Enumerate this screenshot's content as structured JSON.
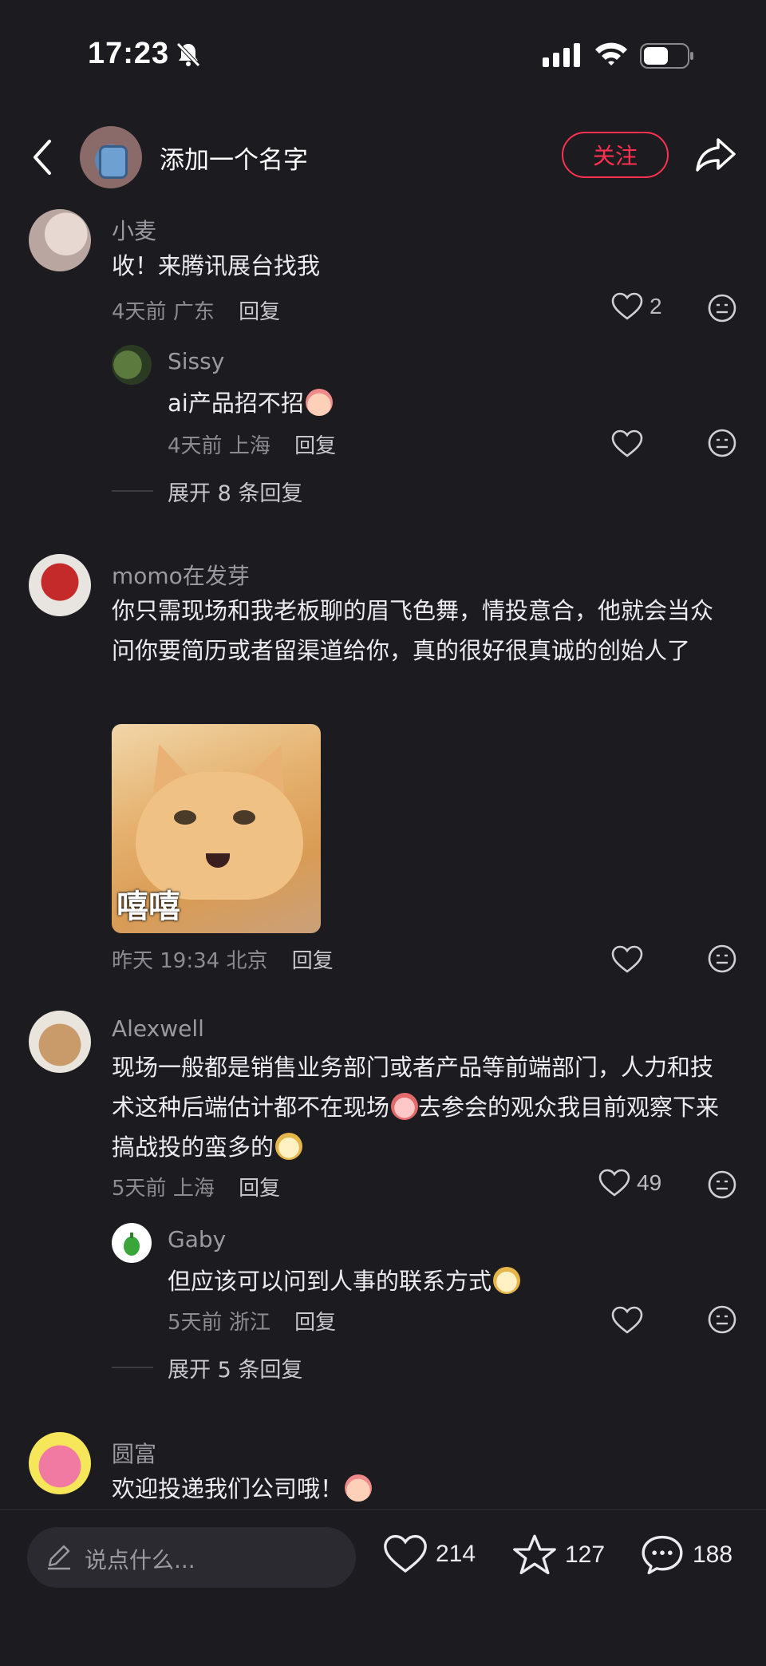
{
  "status": {
    "time": "17:23"
  },
  "nav": {
    "title": "添加一个名字",
    "follow_label": "关注"
  },
  "comments": [
    {
      "user": "小麦",
      "text": "收！来腾讯展台找我",
      "date": "4天前",
      "location": "广东",
      "reply_label": "回复",
      "likes": "2",
      "replies": [
        {
          "user": "Sissy",
          "text": "ai产品招不招",
          "date": "4天前",
          "location": "上海",
          "reply_label": "回复"
        }
      ],
      "expand_label": "展开 8 条回复"
    },
    {
      "user": "momo在发芽",
      "text": "你只需现场和我老板聊的眉飞色舞，情投意合，他就会当众问你要简历或者留渠道给你，真的很好很真诚的创始人了",
      "sticker_caption": "嘻嘻",
      "date": "昨天 19:34",
      "location": "北京",
      "reply_label": "回复"
    },
    {
      "user": "Alexwell",
      "text_parts": [
        "现场一般都是销售业务部门或者产品等前端部门，人力和技术这种后端估计都不在现场",
        "去参会的观众我目前观察下来搞战投的蛮多的"
      ],
      "date": "5天前",
      "location": "上海",
      "reply_label": "回复",
      "likes": "49",
      "replies": [
        {
          "user": "Gaby",
          "text": "但应该可以问到人事的联系方式",
          "date": "5天前",
          "location": "浙江",
          "reply_label": "回复"
        }
      ],
      "expand_label": "展开 5 条回复"
    },
    {
      "user": "圆富",
      "text": "欢迎投递我们公司哦！"
    }
  ],
  "bottom": {
    "placeholder": "说点什么...",
    "like_count": "214",
    "star_count": "127",
    "comment_count": "188"
  },
  "icons": {
    "like": "heart-icon",
    "dislike": "neutral-face-icon",
    "star": "star-icon",
    "comment": "chat-bubble-icon",
    "share": "share-arrow-icon",
    "back": "chevron-left-icon"
  },
  "colors": {
    "accent": "#ff3050",
    "background": "#1c1b20"
  }
}
